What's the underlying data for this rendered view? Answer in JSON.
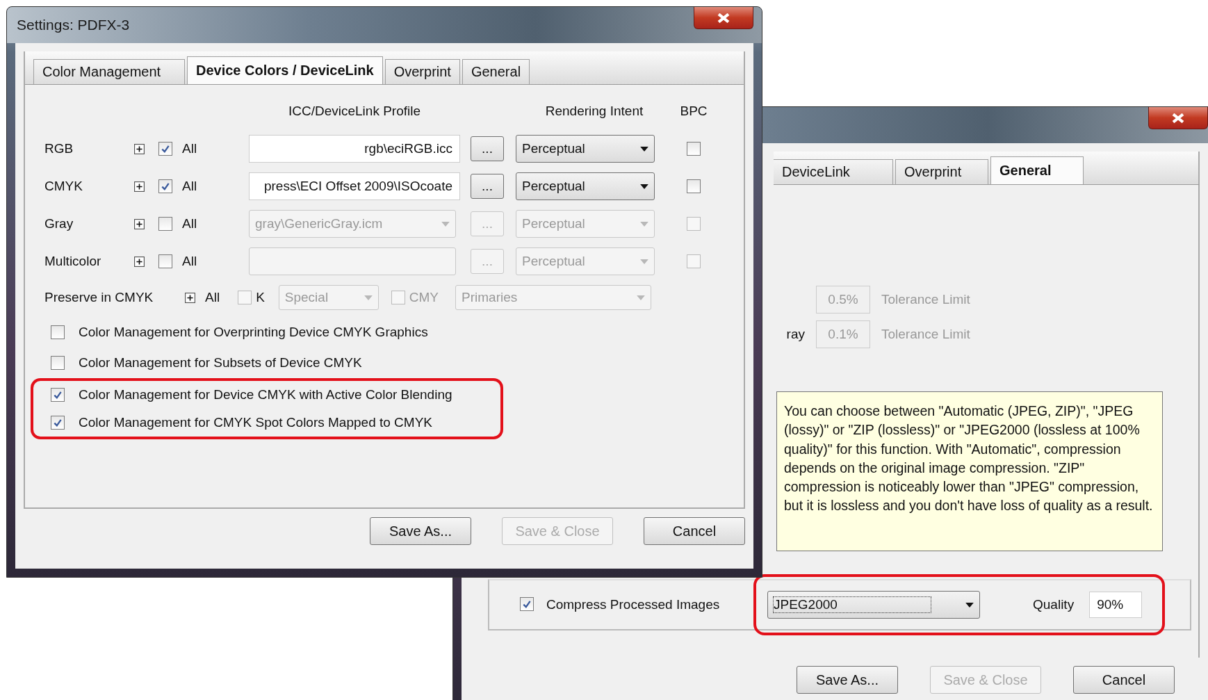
{
  "front_window": {
    "title": "Settings:  PDFX-3",
    "tabs": [
      {
        "label": "Color Management",
        "selected": false
      },
      {
        "label": "Device Colors / DeviceLink",
        "selected": true
      },
      {
        "label": "Overprint",
        "selected": false
      },
      {
        "label": "General",
        "selected": false
      }
    ],
    "headers": {
      "profile": "ICC/DeviceLink Profile",
      "intent": "Rendering Intent",
      "bpc": "BPC"
    },
    "rows": [
      {
        "label": "RGB",
        "all_label": "All",
        "all_checked": true,
        "enabled": true,
        "kind": "field",
        "profile": "rgb\\eciRGB.icc",
        "browse": "...",
        "intent": "Perceptual",
        "bpc_checked": false
      },
      {
        "label": "CMYK",
        "all_label": "All",
        "all_checked": true,
        "enabled": true,
        "kind": "field",
        "profile": "press\\ECI Offset 2009\\ISOcoate",
        "browse": "...",
        "intent": "Perceptual",
        "bpc_checked": false
      },
      {
        "label": "Gray",
        "all_label": "All",
        "all_checked": false,
        "enabled": false,
        "kind": "dropdown",
        "profile": "gray\\GenericGray.icm",
        "browse": "...",
        "intent": "Perceptual",
        "bpc_checked": false
      },
      {
        "label": "Multicolor",
        "all_label": "All",
        "all_checked": false,
        "enabled": false,
        "kind": "dropdown",
        "browse": "...",
        "intent": "Perceptual",
        "bpc_checked": false
      }
    ],
    "preserve": {
      "label": "Preserve in CMYK",
      "all_label": "All",
      "k_checked": false,
      "k_label": "K",
      "special": "Special",
      "cmy_checked": false,
      "cmy_label": "CMY",
      "primaries": "Primaries"
    },
    "options": [
      {
        "label": "Color Management for Overprinting Device CMYK Graphics",
        "checked": false,
        "highlighted": false
      },
      {
        "label": "Color Management for Subsets of Device CMYK",
        "checked": false,
        "highlighted": false
      },
      {
        "label": "Color Management for Device CMYK with Active Color Blending",
        "checked": true,
        "highlighted": true
      },
      {
        "label": "Color Management for CMYK Spot Colors Mapped to CMYK",
        "checked": true,
        "highlighted": true
      }
    ],
    "buttons": [
      {
        "label": "Save As...",
        "disabled": false
      },
      {
        "label": "Save & Close",
        "disabled": true
      },
      {
        "label": "Cancel",
        "disabled": false
      }
    ]
  },
  "back_window": {
    "tabs": [
      {
        "label": "DeviceLink",
        "selected": false
      },
      {
        "label": "Overprint",
        "selected": false
      },
      {
        "label": "General",
        "selected": true
      }
    ],
    "tolerances": [
      {
        "value": "0.5%",
        "note": "Tolerance Limit",
        "disabled": true
      },
      {
        "label": "ray",
        "value": "0.1%",
        "note": "Tolerance Limit",
        "disabled": true
      }
    ],
    "tooltip": "You can choose between \"Automatic (JPEG, ZIP)\", \"JPEG (lossy)\" or \"ZIP (lossless)\" or \"JPEG2000 (lossless at 100% quality)\" for this function. With \"Automatic\", compression depends on the original image compression. \"ZIP\" compression is noticeably lower than \"JPEG\" compression, but it is lossless and you don't have loss of quality as a result.",
    "compression": {
      "checked": true,
      "label": "Compress Processed Images",
      "format": "JPEG2000",
      "quality_label": "Quality",
      "quality": "90%",
      "highlighted": true
    },
    "buttons": [
      {
        "label": "Save As...",
        "disabled": false
      },
      {
        "label": "Save & Close",
        "disabled": true
      },
      {
        "label": "Cancel",
        "disabled": false
      }
    ]
  }
}
